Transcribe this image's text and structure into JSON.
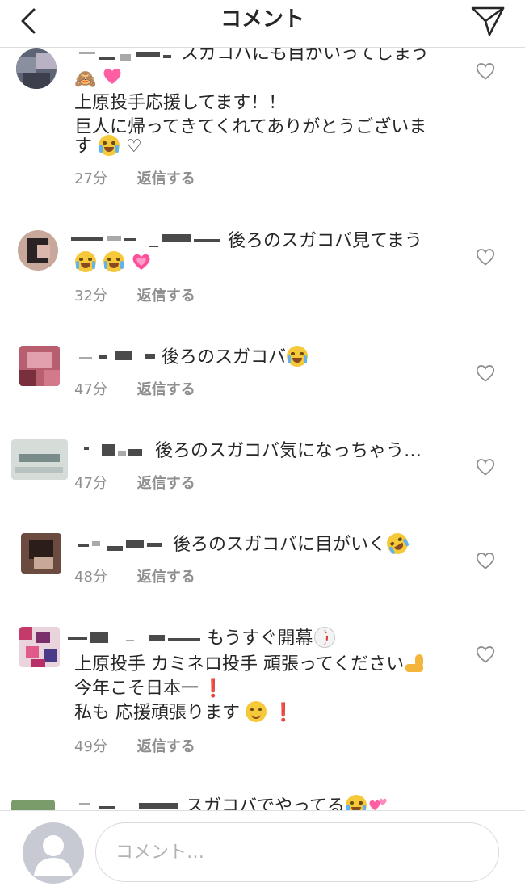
{
  "header": {
    "title": "コメント"
  },
  "comments": [
    {
      "text_lines": [
        "スガコバにも目がいってしまう",
        "上原投手応援してます！！",
        "巨人に帰ってきてくれてありがとうございま",
        "す"
      ],
      "time": "27分",
      "reply_label": "返信する"
    },
    {
      "text_lines": [
        "後ろのスガコバ見てまう"
      ],
      "time": "32分",
      "reply_label": "返信する"
    },
    {
      "text_lines": [
        "後ろのスガコバ"
      ],
      "time": "47分",
      "reply_label": "返信する"
    },
    {
      "text_lines": [
        "後ろのスガコバ気になっちゃう…"
      ],
      "time": "47分",
      "reply_label": "返信する"
    },
    {
      "text_lines": [
        "後ろのスガコバに目がいく"
      ],
      "time": "48分",
      "reply_label": "返信する"
    },
    {
      "text_lines": [
        "もうすぐ開幕",
        "上原投手 カミネロ投手 頑張ってください",
        "今年こそ日本一",
        "私も 応援頑張ります"
      ],
      "time": "49分",
      "reply_label": "返信する"
    },
    {
      "text_lines": [
        "スガコバでやってる"
      ]
    }
  ],
  "emojis": {
    "c1_line1": [
      "see-no-evil-monkey",
      "pink-heart"
    ],
    "c1_line3": [
      "loudly-crying-face",
      "white-heart"
    ],
    "c2_line2": [
      "face-with-tears-of-joy",
      "face-with-tears-of-joy",
      "growing-heart"
    ],
    "c3": [
      "face-with-tears-of-joy"
    ],
    "c5": [
      "rolling-on-floor-laughing"
    ],
    "c6_line1": [
      "baseball"
    ],
    "c6_line2": [
      "flexed-biceps"
    ],
    "c6_line3": [
      "red-exclamation"
    ],
    "c6_line4": [
      "smiling-face",
      "red-exclamation"
    ],
    "c7": [
      "face-with-tears-of-joy",
      "two-hearts"
    ]
  },
  "composer": {
    "placeholder": "コメント…"
  },
  "colors": {
    "text": "#262626",
    "meta": "#8e8e8e",
    "divider": "#dcdcdc",
    "placeholder": "#b3b3b3",
    "avatar_placeholder": "#c7cad3"
  },
  "icons": {
    "back": "chevron-left-icon",
    "send": "paper-plane-icon",
    "like": "heart-outline-icon",
    "profile": "default-avatar-icon"
  }
}
